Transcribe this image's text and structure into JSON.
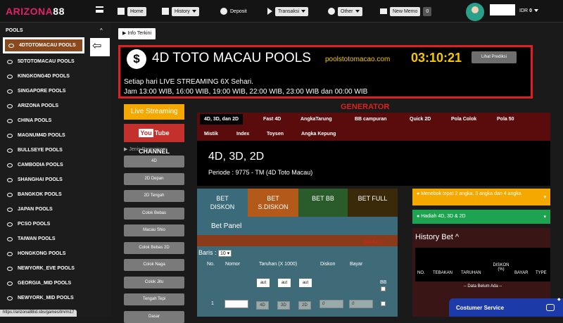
{
  "topbar": {
    "logo_a": "ARIZONA",
    "logo_b": "88",
    "nav": [
      {
        "label": "Home",
        "icon": "home-icon"
      },
      {
        "label": "History",
        "icon": "chart-icon",
        "dropdown": true
      },
      {
        "label": "Deposit",
        "icon": "plus-circle-icon"
      },
      {
        "label": "Transaksi",
        "icon": "play-icon",
        "dropdown": true
      },
      {
        "label": "Other",
        "icon": "info-icon",
        "dropdown": true
      },
      {
        "label": "New Memo",
        "icon": "mail-icon"
      }
    ],
    "memo_count": "0",
    "currency": "IDR",
    "balance": "0"
  },
  "sidebar": {
    "heading": "POOLS",
    "items": [
      "4DTOTOMACAU POOLS",
      "5DTOTOMACAU POOLS",
      "KINGKONG4D POOLS",
      "SINGAPORE POOLS",
      "ARIZONA POOLS",
      "CHINA POOLS",
      "MAGNUM4D POOLS",
      "BULLSEYE POOLS",
      "CAMBODIA POOLS",
      "SHANGHAI POOLS",
      "BANGKOK POOLS",
      "JAPAN POOLS",
      "PCSO POOLS",
      "TAIWAN POOLS",
      "HONGKONG POOLS",
      "NEWYORK_EVE POOLS",
      "GEORGIA_MID POOLS",
      "NEWYORK_MID POOLS"
    ],
    "status_url": "https://arizona88id.sbs/games/tm/m17"
  },
  "info": {
    "button_label": "Info Terkini",
    "title": "4D TOTO MACAU POOLS",
    "site": "poolstotomacao.com",
    "countdown": "03:10:21",
    "predict_label": "Lihat Prediksi",
    "line1": "Setiap hari LIVE STREAMING 6X Sehari.",
    "line2": "Jam 13:00 WIB, 16:00 WIB, 19:00 WIB, 22:00 WIB, 23:00 WIB dan 00:00 WIB"
  },
  "left": {
    "live_label": "Live Streaming",
    "yt_you": "You",
    "yt_rest": "Tube CHANNEL",
    "jenis_label": "Jenis Permainan:",
    "games": [
      "4D",
      "2D Depan",
      "2D Tengah",
      "Colok Bebas",
      "Macau Shio",
      "Colok Bebas 2D",
      "Colok Naga",
      "Colok Jitu",
      "Tengah Tepi",
      "Dasar"
    ]
  },
  "generator": {
    "title": "GENERATOR",
    "tabs_row1": [
      "4D, 3D, dan 2D",
      "Fast 4D",
      "AngkaTarung",
      "BB campuran",
      "Quick 2D",
      "Pola Colok",
      "Pola 50"
    ],
    "tabs_row2": [
      "Mistik",
      "Index",
      "Toysen",
      "Angka Kepung"
    ],
    "section_title": "4D, 3D, 2D",
    "periode": "Periode : 9775 - TM (4D Toto Macau)"
  },
  "bet": {
    "tabs": [
      "BET\nDISKON",
      "BET\nS.DISKON",
      "BET BB",
      "BET FULL"
    ],
    "panel_title": "Bet Panel",
    "total_bet": "Total Bet: 0",
    "baris_label": "Baris :",
    "baris_value": "10",
    "headers": [
      "No.",
      "Nomor",
      "Taruhan (X 1000)",
      "Diskon",
      "Bayar",
      "BB"
    ],
    "aut_label": "aut",
    "row_no": "1",
    "row_cells": [
      "4D",
      "3D",
      "2D",
      "0",
      "0"
    ]
  },
  "right": {
    "info1": "Menebok tepat 2 angka, 3 angka dan 4 angka",
    "info2": "Hadiah 4D, 3D & 2D",
    "history_title": "History Bet",
    "history_headers": [
      "NO.",
      "TEBAKAN",
      "TARUHAN",
      "DISKON (%)",
      "BAYAR",
      "TYPE"
    ],
    "empty_text": "-- Data Belum Ada --"
  },
  "customer_service": "Costumer Service"
}
